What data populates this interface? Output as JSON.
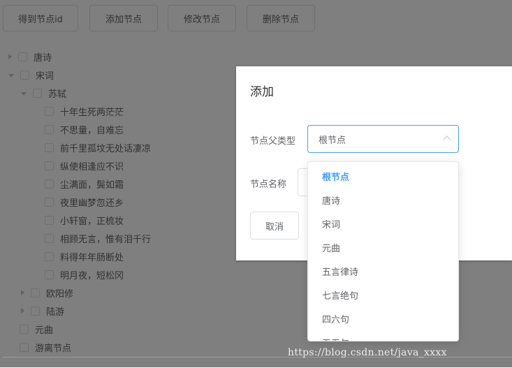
{
  "toolbar": {
    "get_id_label": "得到节点id",
    "add_label": "添加节点",
    "edit_label": "修改节点",
    "delete_label": "删除节点"
  },
  "tree": {
    "nodes": [
      {
        "label": "唐诗",
        "expanded": false
      },
      {
        "label": "宋词",
        "expanded": true
      },
      {
        "label": "苏轼",
        "expanded": true
      },
      {
        "label": "十年生死两茫茫"
      },
      {
        "label": "不思量，自难忘"
      },
      {
        "label": "前千里孤坟无处话凄凉"
      },
      {
        "label": "纵使相逢应不识"
      },
      {
        "label": "尘满面，鬓如霜"
      },
      {
        "label": "夜里幽梦忽还乡"
      },
      {
        "label": "小轩窗，正梳妆"
      },
      {
        "label": "相顾无言，惟有泪千行"
      },
      {
        "label": "料得年年肠断处"
      },
      {
        "label": "明月夜，短松冈"
      },
      {
        "label": "欧阳修",
        "expanded": false
      },
      {
        "label": "陆游",
        "expanded": false
      },
      {
        "label": "元曲"
      },
      {
        "label": "游离节点"
      }
    ]
  },
  "dialog": {
    "title": "添加",
    "parent_type_label": "节点父类型",
    "parent_type_value": "根节点",
    "name_label": "节点名称",
    "cancel_label": "取消"
  },
  "dropdown": {
    "options": [
      "根节点",
      "唐诗",
      "宋词",
      "元曲",
      "五言律诗",
      "七言绝句",
      "四六句",
      "五五句"
    ],
    "selected": "根节点"
  },
  "watermark": "https://blog.csdn.net/java_xxxx",
  "colors": {
    "accent": "#409eff",
    "overlay": "rgba(0,0,0,0.5)"
  }
}
